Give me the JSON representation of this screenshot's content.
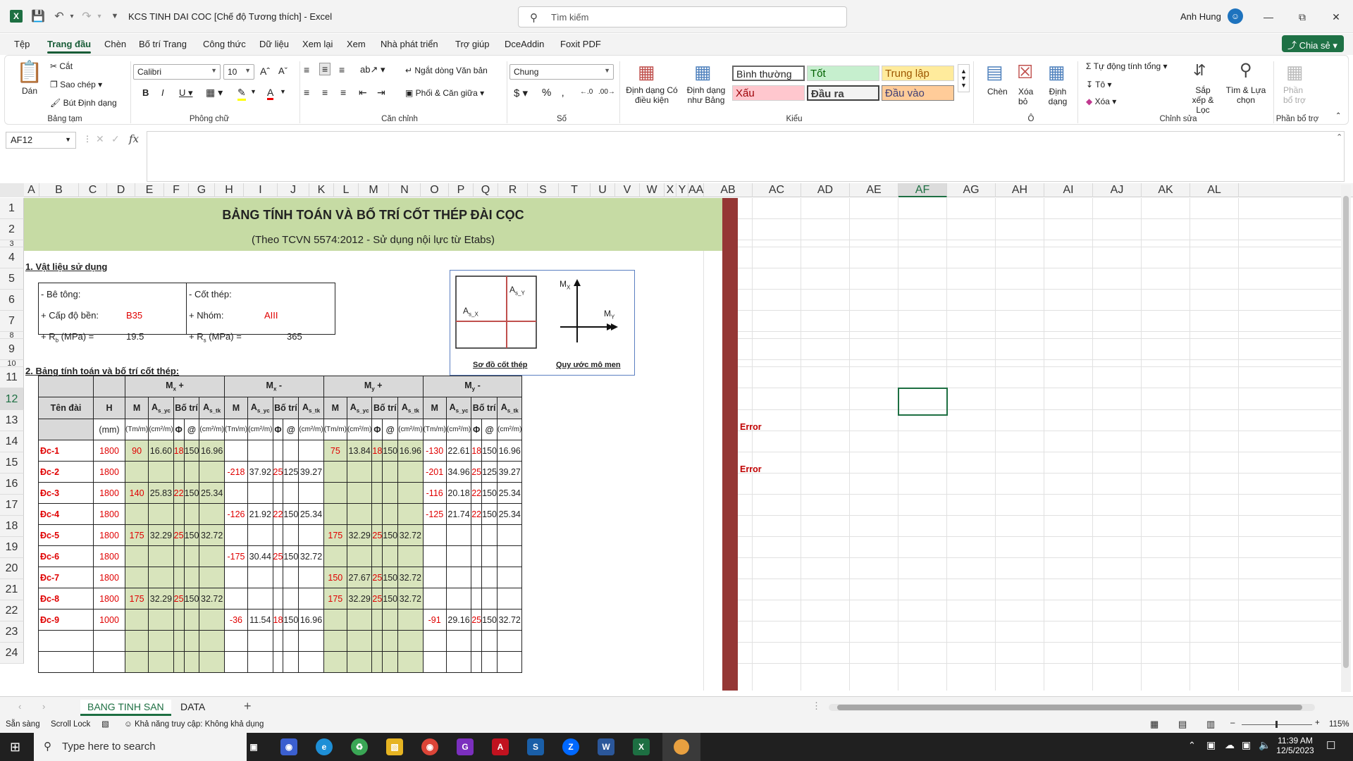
{
  "app": {
    "title": "KCS TINH DAI COC  [Chế độ Tương thích]  -  Excel",
    "search_placeholder": "Tìm kiếm",
    "user": "Anh Hung",
    "share": "Chia sẻ"
  },
  "menu": [
    "Tệp",
    "Trang đầu",
    "Chèn",
    "Bố trí Trang",
    "Công thức",
    "Dữ liệu",
    "Xem lại",
    "Xem",
    "Nhà phát triển",
    "Trợ giúp",
    "DceAddin",
    "Foxit PDF"
  ],
  "ribbon": {
    "paste": "Dán",
    "cut": "Cắt",
    "copy": "Sao chép",
    "format_painter": "Bút Định dạng",
    "g_clipboard": "Bảng tạm",
    "font": "Calibri",
    "size": "10",
    "g_font": "Phông chữ",
    "wrap": "Ngắt dòng Văn bản",
    "merge": "Phối & Căn giữa",
    "g_align": "Căn chỉnh",
    "numfmt": "Chung",
    "g_number": "Số",
    "cond_fmt": "Định dạng Có điều kiện",
    "table_fmt": "Định dạng như Bảng",
    "styles": [
      "Bình thường",
      "Tốt",
      "Trung lập",
      "Xấu",
      "Đầu ra",
      "Đầu vào"
    ],
    "g_styles": "Kiểu",
    "insert": "Chèn",
    "delete": "Xóa bỏ",
    "format": "Định dạng",
    "g_cells": "Ô",
    "autosum": "Tự động tính tổng",
    "fill": "Tô",
    "clear": "Xóa",
    "sort": "Sắp xếp & Lọc",
    "find": "Tìm & Lựa chọn",
    "g_edit": "Chỉnh sửa",
    "addins": "Phần bổ trợ",
    "g_addins": "Phần bổ trợ"
  },
  "namebox": "AF12",
  "columns": [
    "A",
    "B",
    "C",
    "D",
    "E",
    "F",
    "G",
    "H",
    "I",
    "J",
    "K",
    "L",
    "M",
    "N",
    "O",
    "P",
    "Q",
    "R",
    "S",
    "T",
    "U",
    "V",
    "W",
    "X",
    "Y",
    "AA",
    "AB",
    "AC",
    "AD",
    "AE",
    "AF",
    "AG",
    "AH",
    "AI",
    "AJ",
    "AK",
    "AL"
  ],
  "rows": [
    "1",
    "2",
    "3",
    "4",
    "5",
    "6",
    "7",
    "8",
    "9",
    "10",
    "11",
    "12",
    "13",
    "14",
    "15",
    "16",
    "17",
    "18",
    "19",
    "20",
    "21",
    "22",
    "23",
    "24"
  ],
  "sheet": {
    "title": "BẢNG TÍNH TOÁN VÀ BỐ TRÍ CỐT THÉP ĐÀI CỌC",
    "subtitle": "(Theo TCVN 5574:2012 - Sử dụng nội lực từ Etabs)",
    "sec1": "1. Vật liệu sử dụng",
    "sec2": "2. Bảng tính toán và bố trí cốt thép:",
    "mat": {
      "concrete": "- Bê tông:",
      "grade_lbl": "+ Cấp độ bền:",
      "grade": "B35",
      "rb_lbl": "+ R",
      "rb_sub": "b",
      "rb_unit": " (MPa) =",
      "rb": "19.5",
      "steel": "- Cốt thép:",
      "group_lbl": "+ Nhóm:",
      "group": "AIII",
      "rs_lbl": "+ R",
      "rs_sub": "s",
      "rs_unit": " (MPa) =",
      "rs": "365"
    },
    "diagram": {
      "asx": "A",
      "asx_sub": "s_X",
      "asy": "A",
      "asy_sub": "s_Y",
      "mx": "M",
      "mx_sub": "X",
      "my": "M",
      "my_sub": "Y",
      "cap1": "Sơ đồ cốt thép",
      "cap2": "Quy ước mô men"
    },
    "groups": [
      "M",
      "M",
      "M",
      "M"
    ],
    "group_subs": [
      "x",
      "x",
      "y",
      "y"
    ],
    "group_signs": [
      " +",
      " -",
      " +",
      " -"
    ],
    "hdr": {
      "name": "Tên đài",
      "h": "H",
      "m": "M",
      "asyc": "A",
      "asyc_sub": "s_yc",
      "bt": "Bố trí",
      "astk": "A",
      "astk_sub": "s_tk"
    },
    "units": {
      "h": "(mm)",
      "m": "(Tm/m)",
      "as": "(cm²/m)",
      "phi": "Φ",
      "at": "@"
    },
    "data": [
      [
        "Đc-1",
        "1800",
        "90",
        "16.60",
        "18",
        "150",
        "16.96",
        "",
        "",
        "",
        "",
        "",
        "75",
        "13.84",
        "18",
        "150",
        "16.96",
        "-130",
        "22.61",
        "18",
        "150",
        "16.96"
      ],
      [
        "Đc-2",
        "1800",
        "",
        "",
        "",
        "",
        "",
        "-218",
        "37.92",
        "25",
        "125",
        "39.27",
        "",
        "",
        "",
        "",
        "",
        "-201",
        "34.96",
        "25",
        "125",
        "39.27"
      ],
      [
        "Đc-3",
        "1800",
        "140",
        "25.83",
        "22",
        "150",
        "25.34",
        "",
        "",
        "",
        "",
        "",
        "",
        "",
        "",
        "",
        "",
        "-116",
        "20.18",
        "22",
        "150",
        "25.34"
      ],
      [
        "Đc-4",
        "1800",
        "",
        "",
        "",
        "",
        "",
        "-126",
        "21.92",
        "22",
        "150",
        "25.34",
        "",
        "",
        "",
        "",
        "",
        "-125",
        "21.74",
        "22",
        "150",
        "25.34"
      ],
      [
        "Đc-5",
        "1800",
        "175",
        "32.29",
        "25",
        "150",
        "32.72",
        "",
        "",
        "",
        "",
        "",
        "175",
        "32.29",
        "25",
        "150",
        "32.72",
        "",
        "",
        "",
        "",
        ""
      ],
      [
        "Đc-6",
        "1800",
        "",
        "",
        "",
        "",
        "",
        "-175",
        "30.44",
        "25",
        "150",
        "32.72",
        "",
        "",
        "",
        "",
        "",
        "",
        "",
        "",
        "",
        ""
      ],
      [
        "Đc-7",
        "1800",
        "",
        "",
        "",
        "",
        "",
        "",
        "",
        "",
        "",
        "",
        "150",
        "27.67",
        "25",
        "150",
        "32.72",
        "",
        "",
        "",
        "",
        ""
      ],
      [
        "Đc-8",
        "1800",
        "175",
        "32.29",
        "25",
        "150",
        "32.72",
        "",
        "",
        "",
        "",
        "",
        "175",
        "32.29",
        "25",
        "150",
        "32.72",
        "",
        "",
        "",
        "",
        ""
      ],
      [
        "Đc-9",
        "1000",
        "",
        "",
        "",
        "",
        "",
        "-36",
        "11.54",
        "18",
        "150",
        "16.96",
        "",
        "",
        "",
        "",
        "",
        "-91",
        "29.16",
        "25",
        "150",
        "32.72"
      ],
      [
        "",
        "",
        "",
        "",
        "",
        "",
        "",
        "",
        "",
        "",
        "",
        "",
        "",
        "",
        "",
        "",
        "",
        "",
        "",
        "",
        "",
        ""
      ],
      [
        "",
        "",
        "",
        "",
        "",
        "",
        "",
        "",
        "",
        "",
        "",
        "",
        "",
        "",
        "",
        "",
        "",
        "",
        "",
        "",
        "",
        ""
      ]
    ],
    "errors": [
      "Error",
      "Error"
    ]
  },
  "sheets": [
    "BANG TINH SAN",
    "DATA"
  ],
  "status": {
    "ready": "Sẵn sàng",
    "scroll": "Scroll Lock",
    "access": "Khả năng truy cập: Không khả dụng",
    "zoom": "115%"
  },
  "taskbar": {
    "search": "Type here to search",
    "time": "11:39 AM",
    "date": "12/5/2023"
  }
}
